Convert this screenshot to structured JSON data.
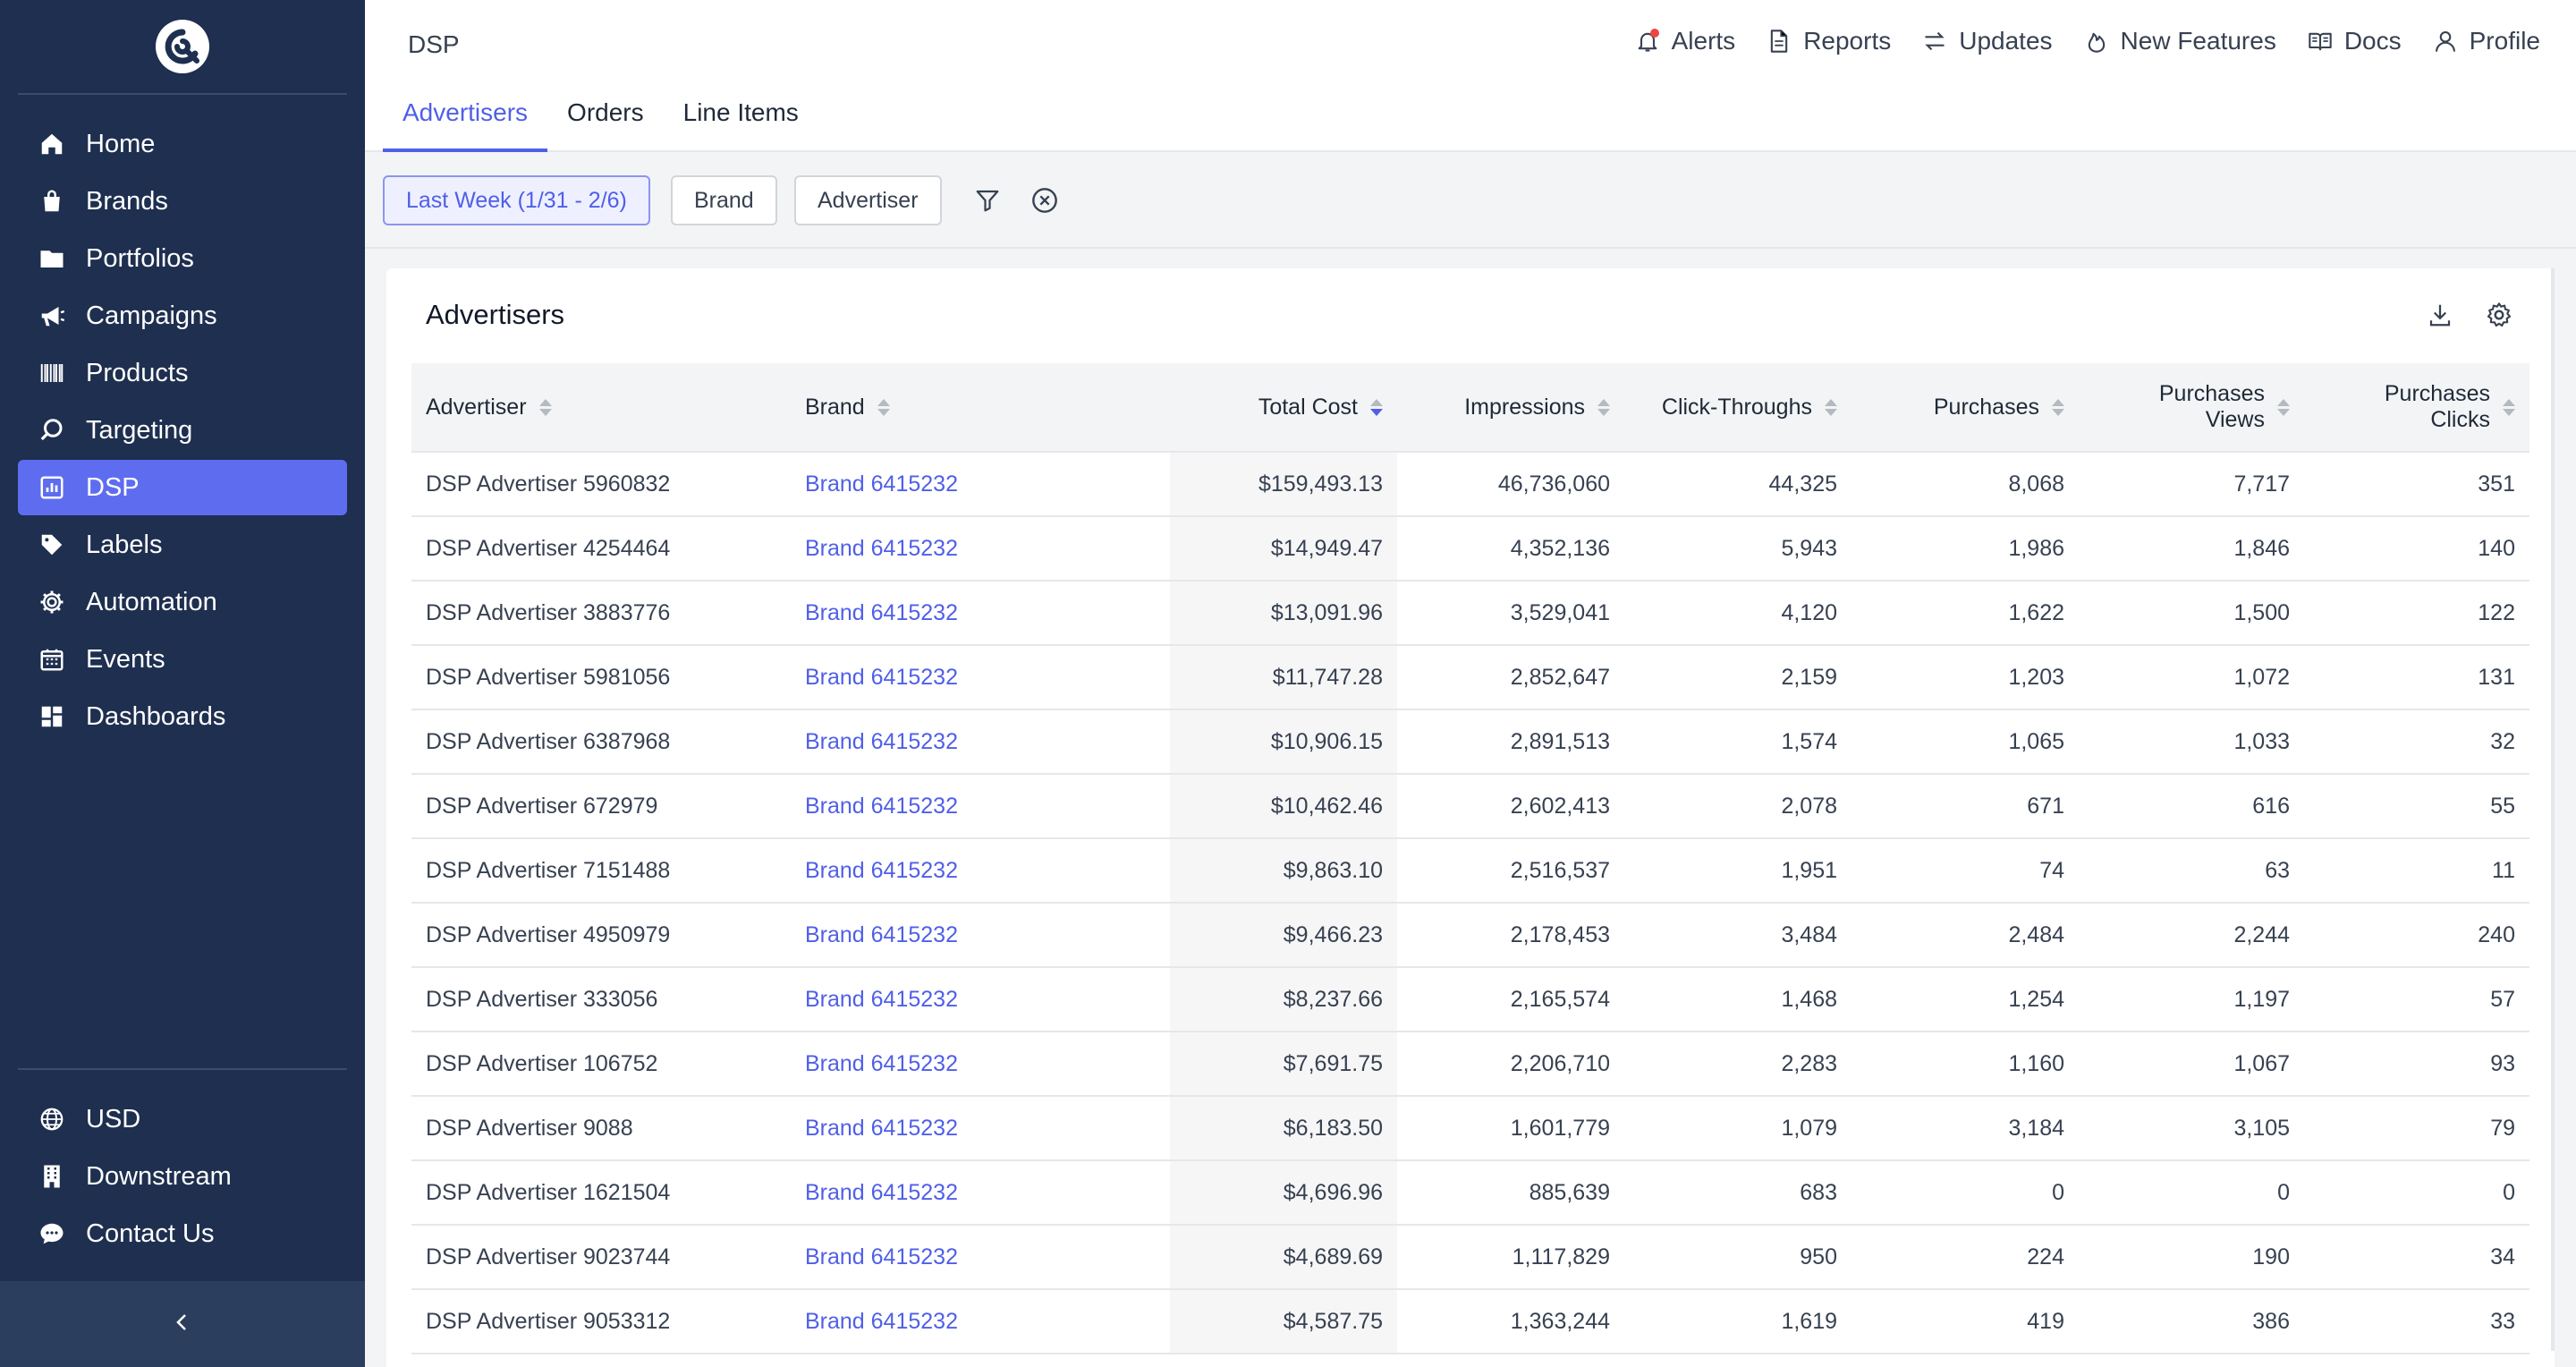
{
  "sidebar": {
    "nav": [
      {
        "label": "Home",
        "icon": "home-icon",
        "name": "home",
        "active": false
      },
      {
        "label": "Brands",
        "icon": "shopping-bag-icon",
        "name": "brands",
        "active": false
      },
      {
        "label": "Portfolios",
        "icon": "folder-icon",
        "name": "portfolios",
        "active": false
      },
      {
        "label": "Campaigns",
        "icon": "megaphone-icon",
        "name": "campaigns",
        "active": false
      },
      {
        "label": "Products",
        "icon": "barcode-icon",
        "name": "products",
        "active": false
      },
      {
        "label": "Targeting",
        "icon": "search-icon",
        "name": "targeting",
        "active": false
      },
      {
        "label": "DSP",
        "icon": "chart-icon",
        "name": "dsp",
        "active": true
      },
      {
        "label": "Labels",
        "icon": "tag-icon",
        "name": "labels",
        "active": false
      },
      {
        "label": "Automation",
        "icon": "gear-icon",
        "name": "automation",
        "active": false
      },
      {
        "label": "Events",
        "icon": "calendar-icon",
        "name": "events",
        "active": false
      },
      {
        "label": "Dashboards",
        "icon": "dashboard-icon",
        "name": "dashboards",
        "active": false
      }
    ],
    "bottom": [
      {
        "label": "USD",
        "icon": "globe-icon",
        "name": "usd"
      },
      {
        "label": "Downstream",
        "icon": "building-icon",
        "name": "downstream"
      },
      {
        "label": "Contact Us",
        "icon": "chat-bubble-icon",
        "name": "contact-us"
      }
    ]
  },
  "header": {
    "breadcrumb": "DSP",
    "links": [
      {
        "label": "Alerts",
        "icon": "bell-icon"
      },
      {
        "label": "Reports",
        "icon": "document-icon"
      },
      {
        "label": "Updates",
        "icon": "arrows-icon"
      },
      {
        "label": "New Features",
        "icon": "flame-icon"
      },
      {
        "label": "Docs",
        "icon": "book-icon"
      },
      {
        "label": "Profile",
        "icon": "user-icon"
      }
    ],
    "tabs": [
      {
        "label": "Advertisers",
        "active": true
      },
      {
        "label": "Orders",
        "active": false
      },
      {
        "label": "Line Items",
        "active": false
      }
    ]
  },
  "filters": {
    "date_range": "Last Week (1/31 - 2/6)",
    "brand": "Brand",
    "advertiser": "Advertiser"
  },
  "table": {
    "title": "Advertisers",
    "columns": [
      {
        "label": "Advertiser",
        "align": "left",
        "sort": "none"
      },
      {
        "label": "Brand",
        "align": "left",
        "sort": "none"
      },
      {
        "label": "Total Cost",
        "align": "right",
        "sort": "desc"
      },
      {
        "label": "Impressions",
        "align": "right",
        "sort": "none"
      },
      {
        "label": "Click-Throughs",
        "align": "right",
        "sort": "none"
      },
      {
        "label": "Purchases",
        "align": "right",
        "sort": "none"
      },
      {
        "label": "Purchases Views",
        "align": "right",
        "sort": "none"
      },
      {
        "label": "Purchases Clicks",
        "align": "right",
        "sort": "none"
      }
    ],
    "rows": [
      [
        "DSP Advertiser 5960832",
        "Brand 6415232",
        "$159,493.13",
        "46,736,060",
        "44,325",
        "8,068",
        "7,717",
        "351"
      ],
      [
        "DSP Advertiser 4254464",
        "Brand 6415232",
        "$14,949.47",
        "4,352,136",
        "5,943",
        "1,986",
        "1,846",
        "140"
      ],
      [
        "DSP Advertiser 3883776",
        "Brand 6415232",
        "$13,091.96",
        "3,529,041",
        "4,120",
        "1,622",
        "1,500",
        "122"
      ],
      [
        "DSP Advertiser 5981056",
        "Brand 6415232",
        "$11,747.28",
        "2,852,647",
        "2,159",
        "1,203",
        "1,072",
        "131"
      ],
      [
        "DSP Advertiser 6387968",
        "Brand 6415232",
        "$10,906.15",
        "2,891,513",
        "1,574",
        "1,065",
        "1,033",
        "32"
      ],
      [
        "DSP Advertiser 672979",
        "Brand 6415232",
        "$10,462.46",
        "2,602,413",
        "2,078",
        "671",
        "616",
        "55"
      ],
      [
        "DSP Advertiser 7151488",
        "Brand 6415232",
        "$9,863.10",
        "2,516,537",
        "1,951",
        "74",
        "63",
        "11"
      ],
      [
        "DSP Advertiser 4950979",
        "Brand 6415232",
        "$9,466.23",
        "2,178,453",
        "3,484",
        "2,484",
        "2,244",
        "240"
      ],
      [
        "DSP Advertiser 333056",
        "Brand 6415232",
        "$8,237.66",
        "2,165,574",
        "1,468",
        "1,254",
        "1,197",
        "57"
      ],
      [
        "DSP Advertiser 106752",
        "Brand 6415232",
        "$7,691.75",
        "2,206,710",
        "2,283",
        "1,160",
        "1,067",
        "93"
      ],
      [
        "DSP Advertiser 9088",
        "Brand 6415232",
        "$6,183.50",
        "1,601,779",
        "1,079",
        "3,184",
        "3,105",
        "79"
      ],
      [
        "DSP Advertiser 1621504",
        "Brand 6415232",
        "$4,696.96",
        "885,639",
        "683",
        "0",
        "0",
        "0"
      ],
      [
        "DSP Advertiser 9023744",
        "Brand 6415232",
        "$4,689.69",
        "1,117,829",
        "950",
        "224",
        "190",
        "34"
      ],
      [
        "DSP Advertiser 9053312",
        "Brand 6415232",
        "$4,587.75",
        "1,363,244",
        "1,619",
        "419",
        "386",
        "33"
      ]
    ]
  },
  "colors": {
    "sidebar_bg": "#1e2f4f",
    "accent": "#5e6df0",
    "link": "#4f5fe8",
    "alert": "#ef4444"
  }
}
